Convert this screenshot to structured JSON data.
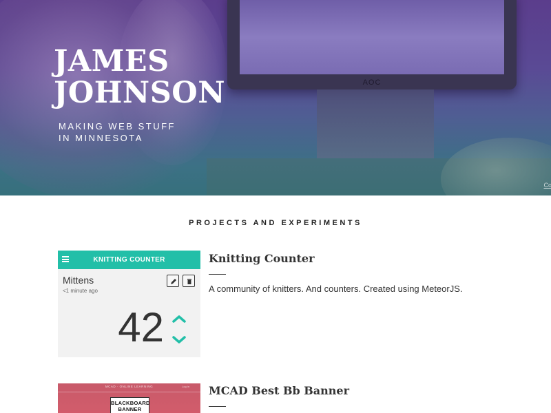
{
  "hero": {
    "name": "JAMES JOHNSON",
    "tagline_line1": "MAKING WEB STUFF",
    "tagline_line2": "IN MINNESOTA",
    "monitor_brand": "AOC",
    "credit": "Coo"
  },
  "section": {
    "title": "PROJECTS AND EXPERIMENTS"
  },
  "projects": [
    {
      "title": "Knitting Counter",
      "description": "A community of knitters. And counters. Created using MeteorJS.",
      "thumbnail": {
        "bar_title": "KNITTING COUNTER",
        "counter_name": "Mittens",
        "counter_time": "<1 minute ago",
        "count": "42",
        "accent": "#22bfa8",
        "icons": [
          "menu-icon",
          "pencil-icon",
          "trash-icon",
          "chevron-up-icon",
          "chevron-down-icon"
        ]
      }
    },
    {
      "title": "MCAD Best Bb Banner",
      "description": "",
      "thumbnail": {
        "nav": "MCAD  ·  ONLINE LEARNING",
        "nav_right": "Log in",
        "badge_line1": "BLACKBOARD",
        "badge_line2": "BANNER",
        "color": "#c85a6a"
      }
    }
  ]
}
